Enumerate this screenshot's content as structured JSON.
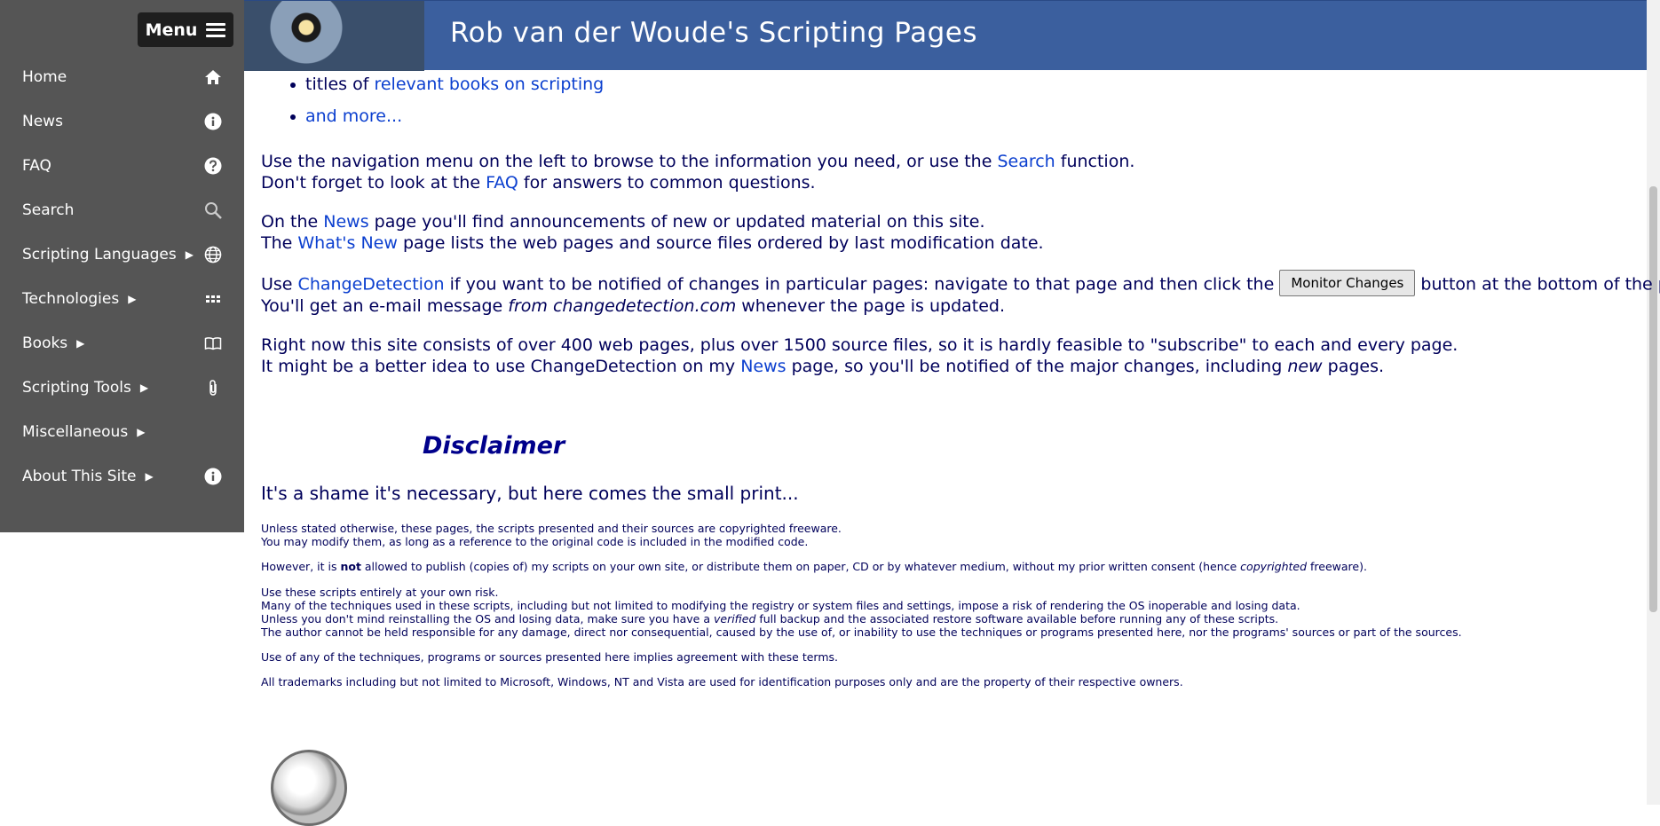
{
  "menu": {
    "label": "Menu",
    "icon": "hamburger-icon"
  },
  "sidebar": {
    "items": [
      {
        "label": "Home",
        "arrow": "",
        "icon": "home-icon"
      },
      {
        "label": "News",
        "arrow": "",
        "icon": "info-icon"
      },
      {
        "label": "FAQ",
        "arrow": "",
        "icon": "help-icon"
      },
      {
        "label": "Search",
        "arrow": "",
        "icon": "search-icon"
      },
      {
        "label": "Scripting Languages",
        "arrow": "▶",
        "icon": "globe-icon"
      },
      {
        "label": "Technologies",
        "arrow": "▶",
        "icon": "grid-icon"
      },
      {
        "label": "Books",
        "arrow": "▶",
        "icon": "book-icon"
      },
      {
        "label": "Scripting Tools",
        "arrow": "▶",
        "icon": "paperclip-icon"
      },
      {
        "label": "Miscellaneous",
        "arrow": "▶",
        "icon": ""
      },
      {
        "label": "About This Site",
        "arrow": "▶",
        "icon": "info-icon"
      }
    ]
  },
  "banner": {
    "title": "Rob van der Woude's Scripting Pages"
  },
  "list": {
    "item1_prefix": "titles of ",
    "item1_link": "relevant books on scripting",
    "item2_link": "and more..."
  },
  "para1": {
    "line1_a": "Use the navigation menu on the left to browse to the information you need, or use the ",
    "line1_link": "Search",
    "line1_b": " function.",
    "line2_a": "Don't forget to look at the ",
    "line2_link": "FAQ",
    "line2_b": " for answers to common questions."
  },
  "para2": {
    "line1_a": "On the ",
    "line1_link": "News",
    "line1_b": " page you'll find announcements of new or updated material on this site.",
    "line2_a": "The ",
    "line2_link": "What's New",
    "line2_b": " page lists the web pages and source files ordered by last modification date."
  },
  "para3": {
    "line1_a": "Use ",
    "line1_link": "ChangeDetection",
    "line1_b": " if you want to be notified of changes in particular pages: navigate to that page and then click the ",
    "button": "Monitor Changes",
    "line1_c": " button at the bottom of the page.",
    "line2_a": "You'll get an e-mail message ",
    "line2_em": "from changedetection.com",
    "line2_b": " whenever the page is updated."
  },
  "para4": {
    "line1": "Right now this site consists of over 400 web pages, plus over 1500 source files, so it is hardly feasible to \"subscribe\" to each and every page.",
    "line2_a": "It might be a better idea to use ChangeDetection on my ",
    "line2_link": "News",
    "line2_b": " page, so you'll be notified of the major changes, including ",
    "line2_em": "new",
    "line2_c": " pages."
  },
  "disclaimer": {
    "heading": "Disclaimer",
    "intro": "It's a shame it's necessary, but here comes the small print...",
    "l1": "Unless stated otherwise, these pages, the scripts presented and their sources are copyrighted freeware.",
    "l2": "You may modify them, as long as a reference to the original code is included in the modified code.",
    "l3_a": "However, it is ",
    "l3_strong": "not",
    "l3_b": " allowed to publish (copies of) my scripts on your own site, or distribute them on paper, CD or by whatever medium, without my prior written consent (hence ",
    "l3_em": "copyrighted",
    "l3_c": " freeware).",
    "l4": "Use these scripts entirely at your own risk.",
    "l5": "Many of the techniques used in these scripts, including but not limited to modifying the registry or system files and settings, impose a risk of rendering the OS inoperable and losing data.",
    "l6_a": "Unless you don't mind reinstalling the OS and losing data, make sure you have a ",
    "l6_em": "verified",
    "l6_b": " full backup and the associated restore software available before running any of these scripts.",
    "l7": "The author cannot be held responsible for any damage, direct nor consequential, caused by the use of, or inability to use the techniques or programs presented here, nor the programs' sources or part of the sources.",
    "l8": "Use of any of the techniques, programs or sources presented here implies agreement with these terms.",
    "l9": "All trademarks including but not limited to Microsoft, Windows, NT and Vista are used for identification purposes only and are the property of their respective owners."
  }
}
